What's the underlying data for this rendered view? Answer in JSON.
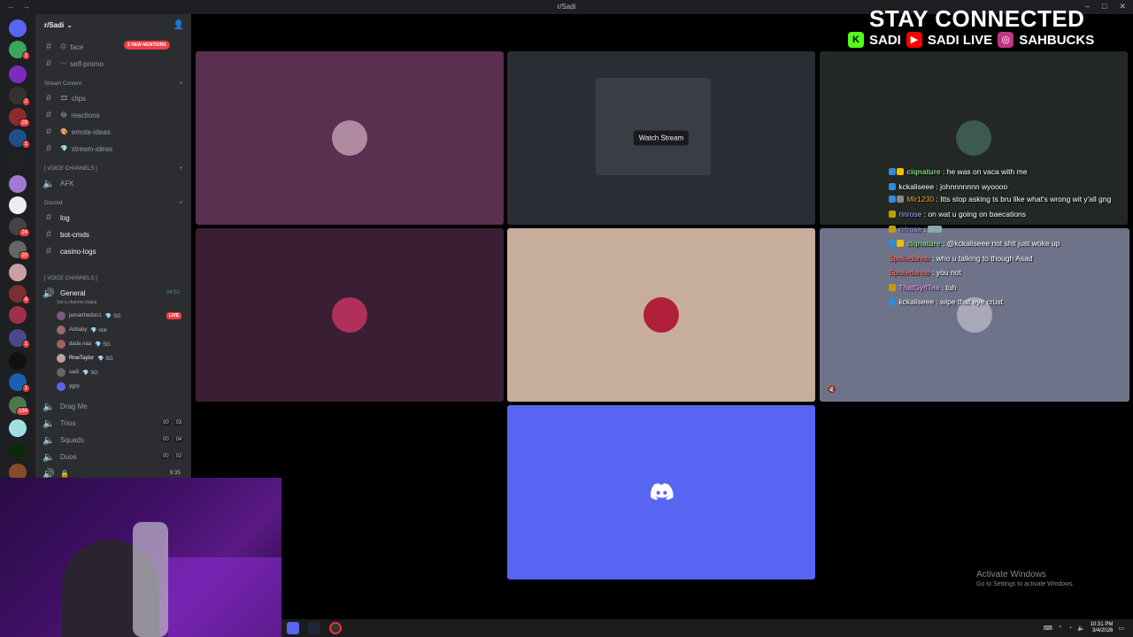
{
  "window": {
    "title": "r/Sadi"
  },
  "overlay": {
    "title": "STAY CONNECTED",
    "socials": [
      {
        "icon": "kick-icon",
        "label": "SADI",
        "color": "#53fc18"
      },
      {
        "icon": "youtube-icon",
        "label": "SADI LIVE",
        "color": "#ff0000"
      },
      {
        "icon": "instagram-icon",
        "label": "SAHBUCKS",
        "color": "#c13584"
      }
    ]
  },
  "server": {
    "name": "r/Sadi",
    "mention_pill": "2 NEW MENTIONS",
    "top_channels": [
      {
        "name": "face",
        "emoji": "😐"
      },
      {
        "name": "self-promo",
        "emoji": "〰"
      }
    ],
    "stream_category": "Stream Content",
    "stream_channels": [
      {
        "name": "clips",
        "emoji": "🎞"
      },
      {
        "name": "reactions",
        "emoji": "😂"
      },
      {
        "name": "emote-ideas",
        "emoji": "🎨"
      },
      {
        "name": "stream-ideas",
        "emoji": "💎"
      }
    ],
    "voice_category_1": "[ VOICE CHANNELS ]",
    "afk_channel": "AFK",
    "discord_category": "Discord",
    "discord_channels": [
      {
        "name": "log"
      },
      {
        "name": "bot-cmds"
      },
      {
        "name": "casino-logs"
      }
    ],
    "voice_category_2": "[ VOICE CHANNELS ]",
    "general": {
      "name": "General",
      "status": "Set a channel status",
      "timer": "24:52"
    },
    "voice_users": [
      {
        "name": "jamarthedon1",
        "tag": "💎 SG",
        "live": "LIVE",
        "color": "#7b5c7e"
      },
      {
        "name": "Aribaby",
        "tag": "💎 rick",
        "color": "#9b6a6a"
      },
      {
        "name": "dada naa",
        "tag": "💎 SG",
        "color": "#a06060"
      },
      {
        "name": "RnwTaylor",
        "tag": "💎 SG",
        "color": "#c0a0a0"
      },
      {
        "name": "sadi",
        "tag": "💎 SG",
        "color": "#666"
      },
      {
        "name": "ygrp",
        "tag": "",
        "color": "#5865f2"
      }
    ],
    "other_voice": [
      {
        "name": "Drag Me",
        "a": "",
        "b": ""
      },
      {
        "name": "Trios",
        "a": "00",
        "b": "03"
      },
      {
        "name": "Squads",
        "a": "00",
        "b": "04"
      },
      {
        "name": "Duos",
        "a": "00",
        "b": "02"
      }
    ],
    "locked_timer": "9:35"
  },
  "stage": {
    "watch_stream": "Watch Stream",
    "tiles": [
      {
        "bg": "#5a2f4f",
        "avatar": "#b08aa0"
      },
      {
        "bg": "#2a2d33",
        "stream": true
      },
      {
        "bg": "#232824",
        "avatar": "#3c5a4e"
      },
      {
        "bg": "#3a1f34",
        "avatar": "#b0305a"
      },
      {
        "bg": "#c7ad9b",
        "avatar": "#b0203a"
      },
      {
        "bg": "#6f7389",
        "avatar": "#a8a8b8"
      },
      {
        "bg": "#5865f2",
        "discord": true
      }
    ]
  },
  "chat": [
    {
      "user": "ciqnature",
      "color": "#7fd37f",
      "msg": "he was on vaca with me"
    },
    {
      "user": "kckaliseee",
      "color": "#ffffff",
      "msg": "johnnnnnnn wyoooo"
    },
    {
      "user": "Mir1230",
      "color": "#f0a030",
      "msg": "Itts stop asking ts bru like what's wrong wit y'all gng",
      "wrap": true
    },
    {
      "user": "ririrose",
      "color": "#9aa8ff",
      "msg": "on wat u going on baecations"
    },
    {
      "user": "ririrose",
      "color": "#9aa8ff",
      "msg": ""
    },
    {
      "user": "ciqnature",
      "color": "#7fd37f",
      "msg": "@kckaliseee not shit just woke up"
    },
    {
      "user": "Spoiledsnob",
      "color": "#ff6b6b",
      "msg": "who u talking to though Asad"
    },
    {
      "user": "Spoiledsnob",
      "color": "#ff6b6b",
      "msg": "you not"
    },
    {
      "user": "ThatGyrlTea",
      "color": "#e6a8ff",
      "msg": "tuh"
    },
    {
      "user": "kckaliseee",
      "color": "#ffffff",
      "msg": "wipe that eye crust"
    }
  ],
  "activate": {
    "line1": "Activate Windows",
    "line2": "Go to Settings to activate Windows."
  },
  "clock": {
    "time": "10:31 PM",
    "date": "3/4/2026"
  }
}
